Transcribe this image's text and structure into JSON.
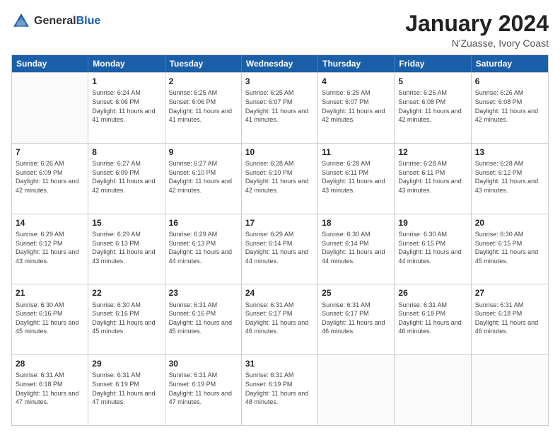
{
  "header": {
    "logo_general": "General",
    "logo_blue": "Blue",
    "month_year": "January 2024",
    "location": "N'Zuasse, Ivory Coast"
  },
  "calendar": {
    "days_of_week": [
      "Sunday",
      "Monday",
      "Tuesday",
      "Wednesday",
      "Thursday",
      "Friday",
      "Saturday"
    ],
    "weeks": [
      [
        {
          "day": "",
          "sunrise": "",
          "sunset": "",
          "daylight": ""
        },
        {
          "day": "1",
          "sunrise": "Sunrise: 6:24 AM",
          "sunset": "Sunset: 6:06 PM",
          "daylight": "Daylight: 11 hours and 41 minutes."
        },
        {
          "day": "2",
          "sunrise": "Sunrise: 6:25 AM",
          "sunset": "Sunset: 6:06 PM",
          "daylight": "Daylight: 11 hours and 41 minutes."
        },
        {
          "day": "3",
          "sunrise": "Sunrise: 6:25 AM",
          "sunset": "Sunset: 6:07 PM",
          "daylight": "Daylight: 11 hours and 41 minutes."
        },
        {
          "day": "4",
          "sunrise": "Sunrise: 6:25 AM",
          "sunset": "Sunset: 6:07 PM",
          "daylight": "Daylight: 11 hours and 42 minutes."
        },
        {
          "day": "5",
          "sunrise": "Sunrise: 6:26 AM",
          "sunset": "Sunset: 6:08 PM",
          "daylight": "Daylight: 11 hours and 42 minutes."
        },
        {
          "day": "6",
          "sunrise": "Sunrise: 6:26 AM",
          "sunset": "Sunset: 6:08 PM",
          "daylight": "Daylight: 11 hours and 42 minutes."
        }
      ],
      [
        {
          "day": "7",
          "sunrise": "Sunrise: 6:26 AM",
          "sunset": "Sunset: 6:09 PM",
          "daylight": "Daylight: 11 hours and 42 minutes."
        },
        {
          "day": "8",
          "sunrise": "Sunrise: 6:27 AM",
          "sunset": "Sunset: 6:09 PM",
          "daylight": "Daylight: 11 hours and 42 minutes."
        },
        {
          "day": "9",
          "sunrise": "Sunrise: 6:27 AM",
          "sunset": "Sunset: 6:10 PM",
          "daylight": "Daylight: 11 hours and 42 minutes."
        },
        {
          "day": "10",
          "sunrise": "Sunrise: 6:28 AM",
          "sunset": "Sunset: 6:10 PM",
          "daylight": "Daylight: 11 hours and 42 minutes."
        },
        {
          "day": "11",
          "sunrise": "Sunrise: 6:28 AM",
          "sunset": "Sunset: 6:11 PM",
          "daylight": "Daylight: 11 hours and 43 minutes."
        },
        {
          "day": "12",
          "sunrise": "Sunrise: 6:28 AM",
          "sunset": "Sunset: 6:11 PM",
          "daylight": "Daylight: 11 hours and 43 minutes."
        },
        {
          "day": "13",
          "sunrise": "Sunrise: 6:28 AM",
          "sunset": "Sunset: 6:12 PM",
          "daylight": "Daylight: 11 hours and 43 minutes."
        }
      ],
      [
        {
          "day": "14",
          "sunrise": "Sunrise: 6:29 AM",
          "sunset": "Sunset: 6:12 PM",
          "daylight": "Daylight: 11 hours and 43 minutes."
        },
        {
          "day": "15",
          "sunrise": "Sunrise: 6:29 AM",
          "sunset": "Sunset: 6:13 PM",
          "daylight": "Daylight: 11 hours and 43 minutes."
        },
        {
          "day": "16",
          "sunrise": "Sunrise: 6:29 AM",
          "sunset": "Sunset: 6:13 PM",
          "daylight": "Daylight: 11 hours and 44 minutes."
        },
        {
          "day": "17",
          "sunrise": "Sunrise: 6:29 AM",
          "sunset": "Sunset: 6:14 PM",
          "daylight": "Daylight: 11 hours and 44 minutes."
        },
        {
          "day": "18",
          "sunrise": "Sunrise: 6:30 AM",
          "sunset": "Sunset: 6:14 PM",
          "daylight": "Daylight: 11 hours and 44 minutes."
        },
        {
          "day": "19",
          "sunrise": "Sunrise: 6:30 AM",
          "sunset": "Sunset: 6:15 PM",
          "daylight": "Daylight: 11 hours and 44 minutes."
        },
        {
          "day": "20",
          "sunrise": "Sunrise: 6:30 AM",
          "sunset": "Sunset: 6:15 PM",
          "daylight": "Daylight: 11 hours and 45 minutes."
        }
      ],
      [
        {
          "day": "21",
          "sunrise": "Sunrise: 6:30 AM",
          "sunset": "Sunset: 6:16 PM",
          "daylight": "Daylight: 11 hours and 45 minutes."
        },
        {
          "day": "22",
          "sunrise": "Sunrise: 6:30 AM",
          "sunset": "Sunset: 6:16 PM",
          "daylight": "Daylight: 11 hours and 45 minutes."
        },
        {
          "day": "23",
          "sunrise": "Sunrise: 6:31 AM",
          "sunset": "Sunset: 6:16 PM",
          "daylight": "Daylight: 11 hours and 45 minutes."
        },
        {
          "day": "24",
          "sunrise": "Sunrise: 6:31 AM",
          "sunset": "Sunset: 6:17 PM",
          "daylight": "Daylight: 11 hours and 46 minutes."
        },
        {
          "day": "25",
          "sunrise": "Sunrise: 6:31 AM",
          "sunset": "Sunset: 6:17 PM",
          "daylight": "Daylight: 11 hours and 46 minutes."
        },
        {
          "day": "26",
          "sunrise": "Sunrise: 6:31 AM",
          "sunset": "Sunset: 6:18 PM",
          "daylight": "Daylight: 11 hours and 46 minutes."
        },
        {
          "day": "27",
          "sunrise": "Sunrise: 6:31 AM",
          "sunset": "Sunset: 6:18 PM",
          "daylight": "Daylight: 11 hours and 46 minutes."
        }
      ],
      [
        {
          "day": "28",
          "sunrise": "Sunrise: 6:31 AM",
          "sunset": "Sunset: 6:18 PM",
          "daylight": "Daylight: 11 hours and 47 minutes."
        },
        {
          "day": "29",
          "sunrise": "Sunrise: 6:31 AM",
          "sunset": "Sunset: 6:19 PM",
          "daylight": "Daylight: 11 hours and 47 minutes."
        },
        {
          "day": "30",
          "sunrise": "Sunrise: 6:31 AM",
          "sunset": "Sunset: 6:19 PM",
          "daylight": "Daylight: 11 hours and 47 minutes."
        },
        {
          "day": "31",
          "sunrise": "Sunrise: 6:31 AM",
          "sunset": "Sunset: 6:19 PM",
          "daylight": "Daylight: 11 hours and 48 minutes."
        },
        {
          "day": "",
          "sunrise": "",
          "sunset": "",
          "daylight": ""
        },
        {
          "day": "",
          "sunrise": "",
          "sunset": "",
          "daylight": ""
        },
        {
          "day": "",
          "sunrise": "",
          "sunset": "",
          "daylight": ""
        }
      ]
    ]
  }
}
